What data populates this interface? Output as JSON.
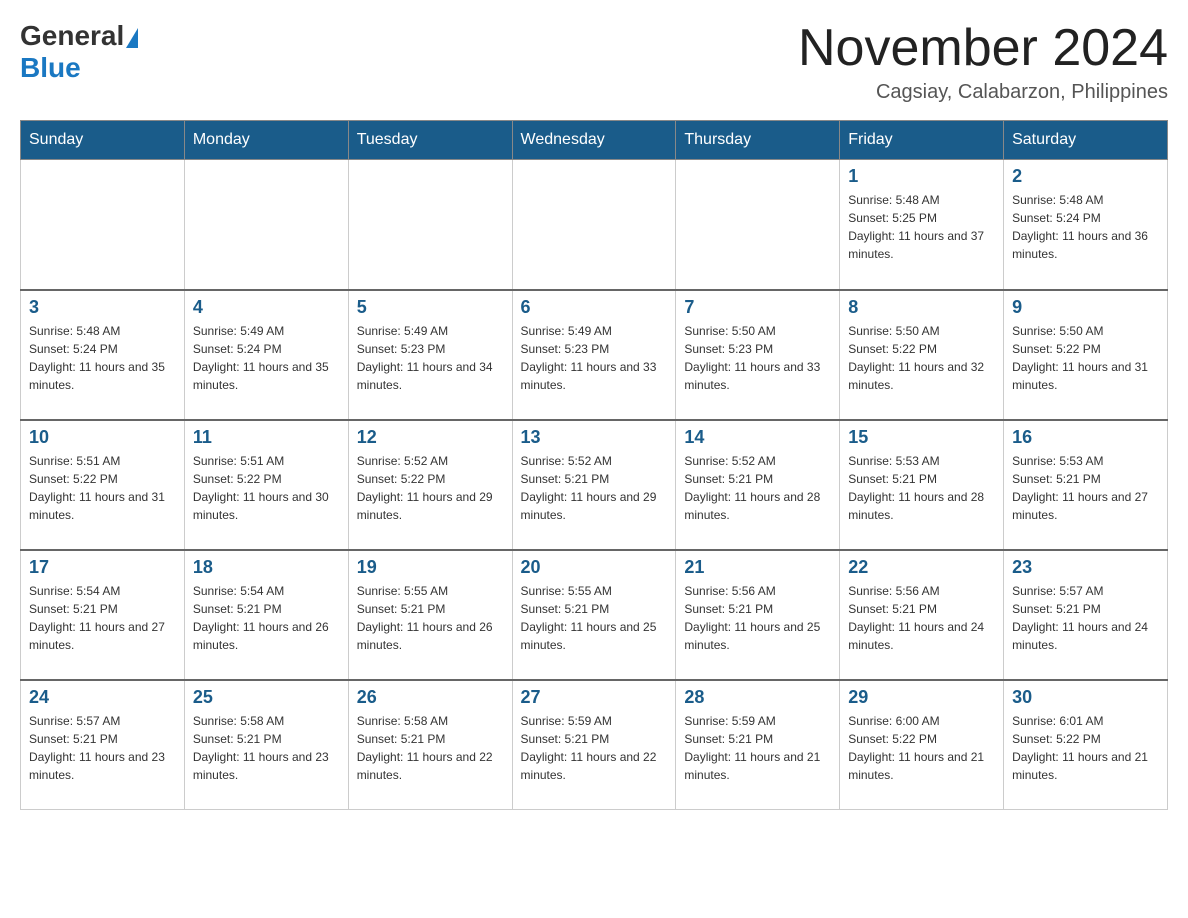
{
  "header": {
    "logo_general": "General",
    "logo_blue": "Blue",
    "month_title": "November 2024",
    "location": "Cagsiay, Calabarzon, Philippines"
  },
  "days_of_week": [
    "Sunday",
    "Monday",
    "Tuesday",
    "Wednesday",
    "Thursday",
    "Friday",
    "Saturday"
  ],
  "weeks": [
    [
      {
        "day": "",
        "info": ""
      },
      {
        "day": "",
        "info": ""
      },
      {
        "day": "",
        "info": ""
      },
      {
        "day": "",
        "info": ""
      },
      {
        "day": "",
        "info": ""
      },
      {
        "day": "1",
        "info": "Sunrise: 5:48 AM\nSunset: 5:25 PM\nDaylight: 11 hours and 37 minutes."
      },
      {
        "day": "2",
        "info": "Sunrise: 5:48 AM\nSunset: 5:24 PM\nDaylight: 11 hours and 36 minutes."
      }
    ],
    [
      {
        "day": "3",
        "info": "Sunrise: 5:48 AM\nSunset: 5:24 PM\nDaylight: 11 hours and 35 minutes."
      },
      {
        "day": "4",
        "info": "Sunrise: 5:49 AM\nSunset: 5:24 PM\nDaylight: 11 hours and 35 minutes."
      },
      {
        "day": "5",
        "info": "Sunrise: 5:49 AM\nSunset: 5:23 PM\nDaylight: 11 hours and 34 minutes."
      },
      {
        "day": "6",
        "info": "Sunrise: 5:49 AM\nSunset: 5:23 PM\nDaylight: 11 hours and 33 minutes."
      },
      {
        "day": "7",
        "info": "Sunrise: 5:50 AM\nSunset: 5:23 PM\nDaylight: 11 hours and 33 minutes."
      },
      {
        "day": "8",
        "info": "Sunrise: 5:50 AM\nSunset: 5:22 PM\nDaylight: 11 hours and 32 minutes."
      },
      {
        "day": "9",
        "info": "Sunrise: 5:50 AM\nSunset: 5:22 PM\nDaylight: 11 hours and 31 minutes."
      }
    ],
    [
      {
        "day": "10",
        "info": "Sunrise: 5:51 AM\nSunset: 5:22 PM\nDaylight: 11 hours and 31 minutes."
      },
      {
        "day": "11",
        "info": "Sunrise: 5:51 AM\nSunset: 5:22 PM\nDaylight: 11 hours and 30 minutes."
      },
      {
        "day": "12",
        "info": "Sunrise: 5:52 AM\nSunset: 5:22 PM\nDaylight: 11 hours and 29 minutes."
      },
      {
        "day": "13",
        "info": "Sunrise: 5:52 AM\nSunset: 5:21 PM\nDaylight: 11 hours and 29 minutes."
      },
      {
        "day": "14",
        "info": "Sunrise: 5:52 AM\nSunset: 5:21 PM\nDaylight: 11 hours and 28 minutes."
      },
      {
        "day": "15",
        "info": "Sunrise: 5:53 AM\nSunset: 5:21 PM\nDaylight: 11 hours and 28 minutes."
      },
      {
        "day": "16",
        "info": "Sunrise: 5:53 AM\nSunset: 5:21 PM\nDaylight: 11 hours and 27 minutes."
      }
    ],
    [
      {
        "day": "17",
        "info": "Sunrise: 5:54 AM\nSunset: 5:21 PM\nDaylight: 11 hours and 27 minutes."
      },
      {
        "day": "18",
        "info": "Sunrise: 5:54 AM\nSunset: 5:21 PM\nDaylight: 11 hours and 26 minutes."
      },
      {
        "day": "19",
        "info": "Sunrise: 5:55 AM\nSunset: 5:21 PM\nDaylight: 11 hours and 26 minutes."
      },
      {
        "day": "20",
        "info": "Sunrise: 5:55 AM\nSunset: 5:21 PM\nDaylight: 11 hours and 25 minutes."
      },
      {
        "day": "21",
        "info": "Sunrise: 5:56 AM\nSunset: 5:21 PM\nDaylight: 11 hours and 25 minutes."
      },
      {
        "day": "22",
        "info": "Sunrise: 5:56 AM\nSunset: 5:21 PM\nDaylight: 11 hours and 24 minutes."
      },
      {
        "day": "23",
        "info": "Sunrise: 5:57 AM\nSunset: 5:21 PM\nDaylight: 11 hours and 24 minutes."
      }
    ],
    [
      {
        "day": "24",
        "info": "Sunrise: 5:57 AM\nSunset: 5:21 PM\nDaylight: 11 hours and 23 minutes."
      },
      {
        "day": "25",
        "info": "Sunrise: 5:58 AM\nSunset: 5:21 PM\nDaylight: 11 hours and 23 minutes."
      },
      {
        "day": "26",
        "info": "Sunrise: 5:58 AM\nSunset: 5:21 PM\nDaylight: 11 hours and 22 minutes."
      },
      {
        "day": "27",
        "info": "Sunrise: 5:59 AM\nSunset: 5:21 PM\nDaylight: 11 hours and 22 minutes."
      },
      {
        "day": "28",
        "info": "Sunrise: 5:59 AM\nSunset: 5:21 PM\nDaylight: 11 hours and 21 minutes."
      },
      {
        "day": "29",
        "info": "Sunrise: 6:00 AM\nSunset: 5:22 PM\nDaylight: 11 hours and 21 minutes."
      },
      {
        "day": "30",
        "info": "Sunrise: 6:01 AM\nSunset: 5:22 PM\nDaylight: 11 hours and 21 minutes."
      }
    ]
  ]
}
